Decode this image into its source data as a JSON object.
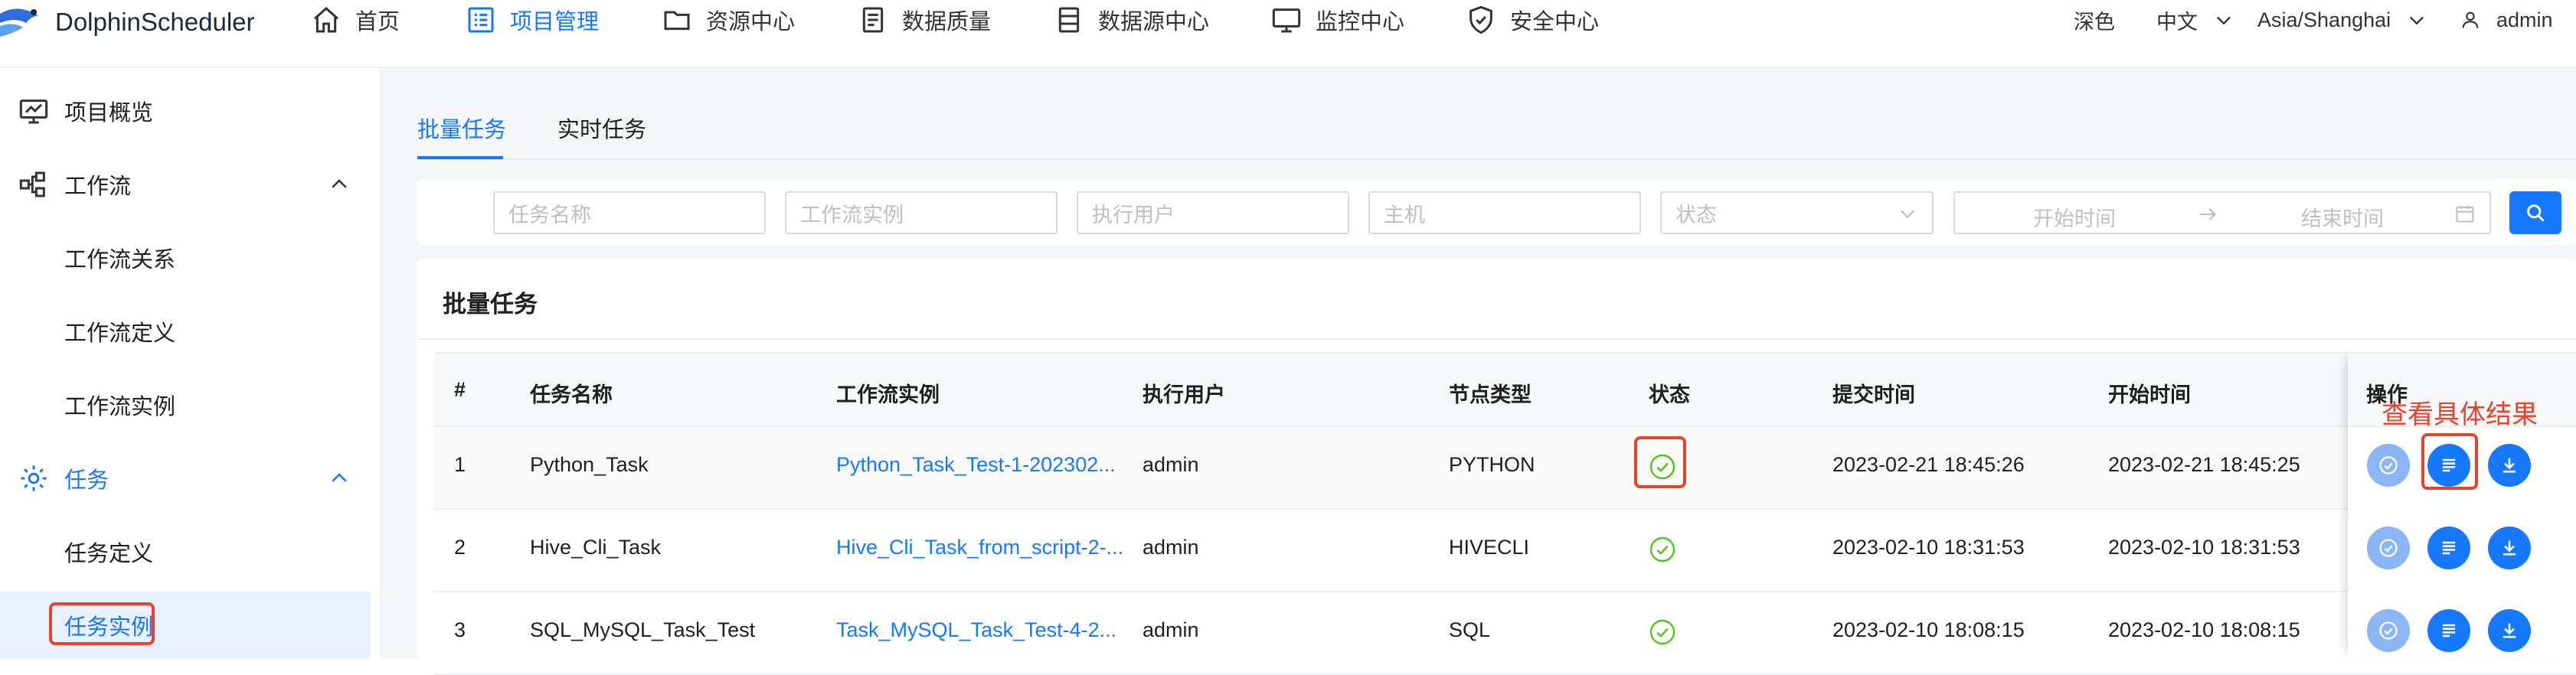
{
  "app": {
    "name": "DolphinScheduler"
  },
  "nav": [
    {
      "label": "首页",
      "icon": "home-icon"
    },
    {
      "label": "项目管理",
      "icon": "project-icon",
      "active": true
    },
    {
      "label": "资源中心",
      "icon": "folder-icon"
    },
    {
      "label": "数据质量",
      "icon": "data-quality-icon"
    },
    {
      "label": "数据源中心",
      "icon": "datasource-icon"
    },
    {
      "label": "监控中心",
      "icon": "monitor-icon"
    },
    {
      "label": "安全中心",
      "icon": "shield-icon"
    }
  ],
  "header_right": {
    "theme": "深色",
    "language": "中文",
    "timezone": "Asia/Shanghai",
    "user": "admin"
  },
  "sidebar": {
    "items": [
      {
        "label": "项目概览",
        "icon": "project-overview-icon"
      },
      {
        "label": "工作流",
        "icon": "workflow-icon",
        "expanded": true
      },
      {
        "label": "工作流关系"
      },
      {
        "label": "工作流定义"
      },
      {
        "label": "工作流实例"
      },
      {
        "label": "任务",
        "icon": "gear-icon",
        "expanded": true
      },
      {
        "label": "任务定义"
      },
      {
        "label": "任务实例",
        "selected": true
      }
    ]
  },
  "tabs": [
    {
      "label": "批量任务",
      "active": true
    },
    {
      "label": "实时任务"
    }
  ],
  "filters": {
    "task_name": "任务名称",
    "workflow_instance": "工作流实例",
    "executor": "执行用户",
    "host": "主机",
    "status": "状态",
    "start_time": "开始时间",
    "end_time": "结束时间"
  },
  "card": {
    "title": "批量任务"
  },
  "table": {
    "columns": [
      "#",
      "任务名称",
      "工作流实例",
      "执行用户",
      "节点类型",
      "状态",
      "提交时间",
      "开始时间",
      "操作"
    ],
    "rows": [
      {
        "index": "1",
        "task_name": "Python_Task",
        "workflow_instance": "Python_Task_Test-1-202302...",
        "executor": "admin",
        "node_type": "PYTHON",
        "status": "success",
        "submit_time": "2023-02-21 18:45:26",
        "start_time": "2023-02-21 18:45:25"
      },
      {
        "index": "2",
        "task_name": "Hive_Cli_Task",
        "workflow_instance": "Hive_Cli_Task_from_script-2-...",
        "executor": "admin",
        "node_type": "HIVECLI",
        "status": "success",
        "submit_time": "2023-02-10 18:31:53",
        "start_time": "2023-02-10 18:31:53"
      },
      {
        "index": "3",
        "task_name": "SQL_MySQL_Task_Test",
        "workflow_instance": "Task_MySQL_Task_Test-4-2...",
        "executor": "admin",
        "node_type": "SQL",
        "status": "success",
        "submit_time": "2023-02-10 18:08:15",
        "start_time": "2023-02-10 18:08:15"
      }
    ]
  },
  "annotation": {
    "text": "查看具体结果"
  },
  "colors": {
    "accent": "#1677ff",
    "success": "#52c41a",
    "highlight": "#e8412c"
  }
}
